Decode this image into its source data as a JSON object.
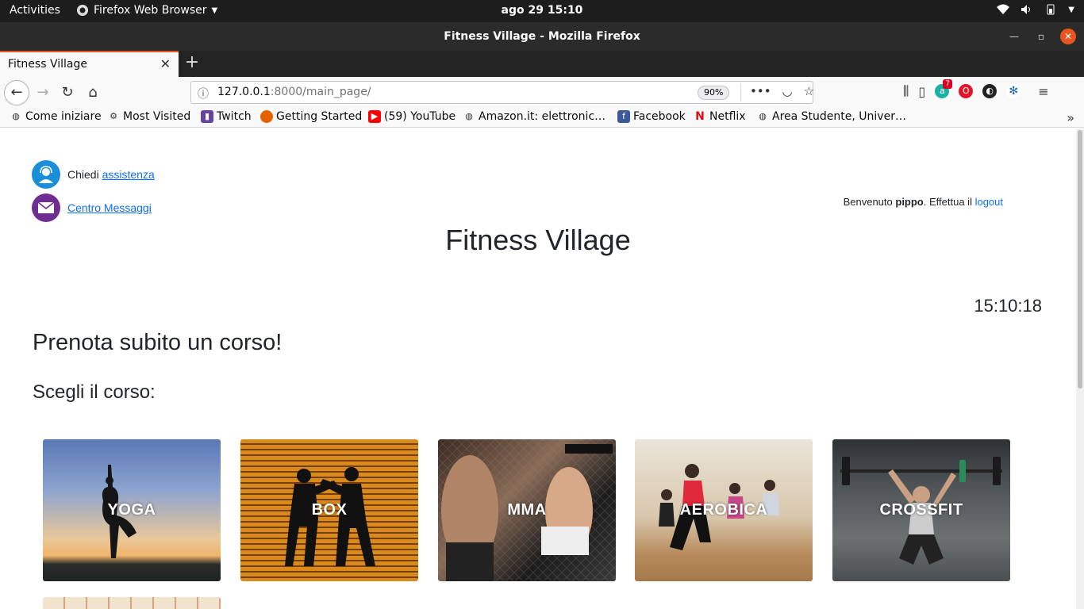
{
  "system": {
    "activities": "Activities",
    "app_name": "Firefox Web Browser",
    "datetime": "ago 29  15:10"
  },
  "window": {
    "title": "Fitness Village - Mozilla Firefox"
  },
  "tabs": [
    {
      "title": "Fitness Village"
    }
  ],
  "navbar": {
    "url_host": "127.0.0.1",
    "url_rest": ":8000/main_page/",
    "zoom": "90%",
    "ext_badge": "7"
  },
  "bookmarks": [
    {
      "label": "Come iniziare",
      "icon": "globe-icon"
    },
    {
      "label": "Most Visited",
      "icon": "gear-icon"
    },
    {
      "label": "Twitch",
      "icon": "twitch-icon"
    },
    {
      "label": "Getting Started",
      "icon": "firefox-icon"
    },
    {
      "label": "(59) YouTube",
      "icon": "youtube-icon"
    },
    {
      "label": "Amazon.it: elettronic…",
      "icon": "globe-icon"
    },
    {
      "label": "Facebook",
      "icon": "facebook-icon"
    },
    {
      "label": "Netflix",
      "icon": "netflix-icon"
    },
    {
      "label": "Area Studente, Univer…",
      "icon": "globe-icon"
    }
  ],
  "page": {
    "help_prefix": "Chiedi",
    "help_link": "assistenza",
    "messages_link": "Centro Messaggi",
    "welcome_prefix": "Benvenuto",
    "username": "pippo",
    "welcome_middle": ". Effettua il",
    "logout": "logout",
    "site_title": "Fitness Village",
    "clock": "15:10:18",
    "heading": "Prenota subito un corso!",
    "subheading": "Scegli il corso:",
    "courses": [
      {
        "label": "YOGA"
      },
      {
        "label": "BOX"
      },
      {
        "label": "MMA"
      },
      {
        "label": "AEROBICA"
      },
      {
        "label": "CROSSFIT"
      }
    ]
  },
  "colors": {
    "accent": "#e95420",
    "link": "#0d6efd",
    "help_icon_bg": "#1a8ed8",
    "messages_icon_bg": "#6f2c91"
  }
}
